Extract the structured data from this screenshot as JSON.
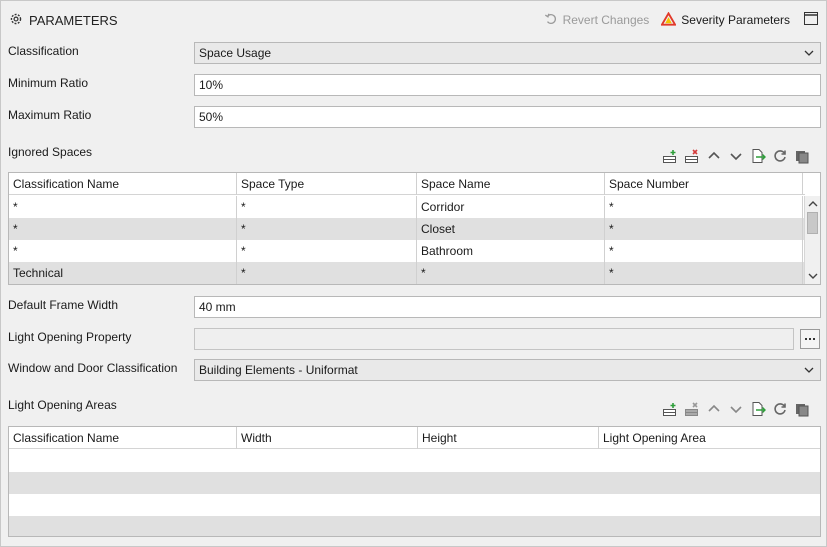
{
  "header": {
    "title": "PARAMETERS",
    "revert_label": "Revert Changes",
    "severity_label": "Severity Parameters"
  },
  "fields": {
    "classification": {
      "label": "Classification",
      "value": "Space Usage"
    },
    "min_ratio": {
      "label": "Minimum Ratio",
      "value": "10%"
    },
    "max_ratio": {
      "label": "Maximum Ratio",
      "value": "50%"
    },
    "default_frame_width": {
      "label": "Default Frame Width",
      "value": "40 mm"
    },
    "light_opening_property": {
      "label": "Light Opening Property",
      "value": ""
    },
    "window_door_classification": {
      "label": "Window and Door Classification",
      "value": "Building Elements - Uniformat"
    }
  },
  "ignored_spaces": {
    "label": "Ignored Spaces",
    "columns": [
      "Classification Name",
      "Space Type",
      "Space Name",
      "Space Number"
    ],
    "rows": [
      [
        "*",
        "*",
        "Corridor",
        "*"
      ],
      [
        "*",
        "*",
        "Closet",
        "*"
      ],
      [
        "*",
        "*",
        "Bathroom",
        "*"
      ],
      [
        "Technical",
        "*",
        "*",
        "*"
      ]
    ]
  },
  "light_opening_areas": {
    "label": "Light Opening Areas",
    "columns": [
      "Classification Name",
      "Width",
      "Height",
      "Light Opening Area"
    ],
    "rows": []
  },
  "colors": {
    "severity_red": "#e23a2a",
    "severity_yellow": "#f3c400",
    "add_green": "#2e9e3a",
    "remove_red": "#d43b3b"
  }
}
